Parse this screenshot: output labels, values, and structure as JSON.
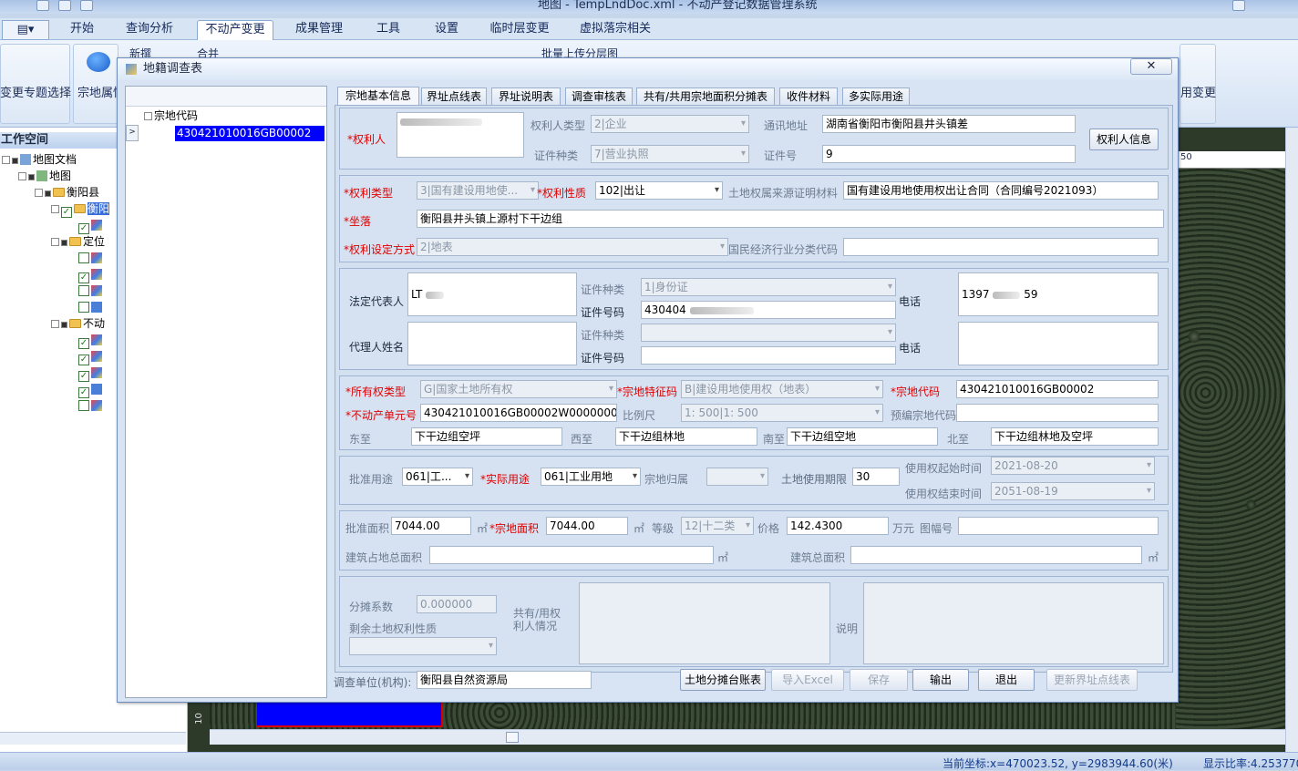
{
  "window": {
    "title": "地图 - TempLndDoc.xml - 不动产登记数据管理系统"
  },
  "menu": {
    "tabs": [
      "开始",
      "查询分析",
      "不动产变更",
      "成果管理",
      "工具",
      "设置",
      "临时层变更",
      "虚拟落宗相关"
    ],
    "active": "不动产变更"
  },
  "ribbon": {
    "topic_select": "变更专题选择",
    "zongdi_attr": "宗地属性",
    "new": "新撰",
    "merge": "合并",
    "batch_upload": "批量上传分层图",
    "right_change": "用变更"
  },
  "workspace": {
    "title": "工作空间",
    "tree": {
      "root": "地图文档",
      "map": "地图",
      "county": "衡阳县",
      "hengyang": "衡阳",
      "locate": "定位",
      "bdc": "不动"
    }
  },
  "map": {
    "ruler_value": "50",
    "side_label": "10"
  },
  "status": {
    "coords": "当前坐标:x=470023.52, y=2983944.60(米)",
    "scale": "显示比率:4.253770"
  },
  "dialog": {
    "title": "地籍调查表",
    "close": "✕",
    "tree": {
      "root": "宗地代码",
      "item": "430421010016GB00002"
    },
    "tabs": [
      "宗地基本信息",
      "界址点线表",
      "界址说明表",
      "调查审核表",
      "共有/共用宗地面积分摊表",
      "收件材料",
      "多实际用途"
    ],
    "active_tab": "宗地基本信息",
    "owner": {
      "label": "*权利人",
      "owner_type_label": "权利人类型",
      "owner_type": "2|企业",
      "cert_type_label": "证件种类",
      "cert_type": "7|营业执照",
      "address_label": "通讯地址",
      "address": "湖南省衡阳市衡阳县井头镇差",
      "cert_no_label": "证件号",
      "cert_no": "9",
      "info_button": "权利人信息"
    },
    "right": {
      "type_label": "*权利类型",
      "type": "3|国有建设用地使...",
      "nature_label": "*权利性质",
      "nature": "102|出让",
      "source_label": "土地权属来源证明材料",
      "source": "国有建设用地使用权出让合同（合同编号2021093）",
      "location_label": "*坐落",
      "location": "衡阳县井头镇上源村下干边组",
      "setup_label": "*权利设定方式",
      "setup": "2|地表",
      "industry_label": "国民经济行业分类代码",
      "industry": ""
    },
    "legal": {
      "rep_label": "法定代表人",
      "rep_name": "LT",
      "cert_type_label": "证件种类",
      "cert_type": "1|身份证",
      "cert_no_label": "证件号码",
      "cert_no": "430404",
      "phone_label": "电话",
      "phone": "1397",
      "phone_tail": "59",
      "agent_label": "代理人姓名",
      "agent_cert_type_label": "证件种类",
      "agent_cert_no_label": "证件号码",
      "agent_phone_label": "电话"
    },
    "parcel": {
      "own_type_label": "*所有权类型",
      "own_type": "G|国家土地所有权",
      "feature_label": "*宗地特征码",
      "feature": "B|建设用地使用权（地表）",
      "code_label": "*宗地代码",
      "code": "430421010016GB00002",
      "unit_label": "*不动产单元号",
      "unit": "430421010016GB00002W00000000",
      "scale_label": "比例尺",
      "scale": "1: 500|1: 500",
      "pre_code_label": "预编宗地代码",
      "pre_code": "",
      "east_label": "东至",
      "east": "下干边组空坪",
      "west_label": "西至",
      "west": "下干边组林地",
      "south_label": "南至",
      "south": "下干边组空地",
      "north_label": "北至",
      "north": "下干边组林地及空坪"
    },
    "use": {
      "approved_label": "批准用途",
      "approved": "061|工...",
      "actual_label": "*实际用途",
      "actual": "061|工业用地",
      "belong_label": "宗地归属",
      "belong": "",
      "term_label": "土地使用期限",
      "term": "30",
      "start_label": "使用权起始时间",
      "start": "2021-08-20",
      "end_label": "使用权结束时间",
      "end": "2051-08-19"
    },
    "area": {
      "approved_label": "批准面积",
      "approved": "7044.00",
      "unit": "㎡",
      "zd_label": "*宗地面积",
      "zd": "7044.00",
      "grade_label": "等级",
      "grade": "12|十二类",
      "price_label": "价格",
      "price": "142.4300",
      "price_unit": "万元",
      "sheet_label": "图幅号",
      "sheet": "",
      "cover_label": "建筑占地总面积",
      "cover": "",
      "total_label": "建筑总面积",
      "total": ""
    },
    "share": {
      "coef_label": "分摊系数",
      "coef": "0.000000",
      "remain_label": "剩余土地权利性质",
      "remain": "",
      "shared_label": "共有/用权利人情况",
      "note_label": "说明"
    },
    "footer": {
      "unit_label": "调查单位(机构):",
      "unit": "衡阳县自然资源局",
      "btn_ledger": "土地分摊台账表",
      "btn_import": "导入Excel",
      "btn_save": "保存",
      "btn_export": "输出",
      "btn_exit": "退出",
      "btn_update": "更新界址点线表"
    }
  }
}
